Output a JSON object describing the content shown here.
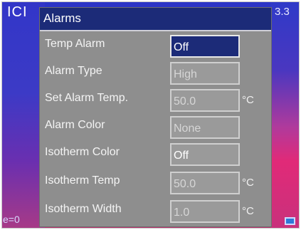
{
  "brand": "ICI",
  "top_right_value": "3.3",
  "emissivity_prefix": "e=0",
  "dialog": {
    "title": "Alarms",
    "rows": [
      {
        "label": "Temp Alarm",
        "value": "Off",
        "unit": ""
      },
      {
        "label": "Alarm Type",
        "value": "High",
        "unit": ""
      },
      {
        "label": "Set Alarm Temp.",
        "value": "50.0",
        "unit": "°C"
      },
      {
        "label": "Alarm Color",
        "value": "None",
        "unit": ""
      },
      {
        "label": "Isotherm Color",
        "value": "Off",
        "unit": ""
      },
      {
        "label": "Isotherm Temp",
        "value": "50.0",
        "unit": "°C"
      },
      {
        "label": "Isotherm Width",
        "value": "1.0",
        "unit": "°C"
      }
    ]
  },
  "colors": {
    "title_bar": "#1c2b78",
    "dialog_bg": "#8e8e8e",
    "selected_field": "#1c2b78",
    "swatch": "#2e78d8"
  }
}
